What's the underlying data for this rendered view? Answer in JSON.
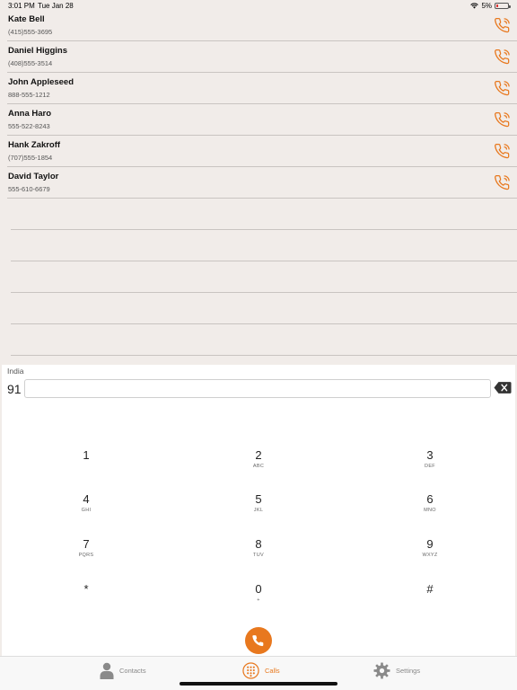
{
  "status": {
    "time": "3:01 PM",
    "date": "Tue Jan 28",
    "battery": "5%"
  },
  "contacts": [
    {
      "name": "Kate Bell",
      "phone": "(415)555-3695"
    },
    {
      "name": "Daniel Higgins",
      "phone": "(408)555-3514"
    },
    {
      "name": "John Appleseed",
      "phone": "888-555-1212"
    },
    {
      "name": "Anna Haro",
      "phone": "555-522-8243"
    },
    {
      "name": "Hank Zakroff",
      "phone": "(707)555-1854"
    },
    {
      "name": "David Taylor",
      "phone": "555-610-6679"
    }
  ],
  "dialer": {
    "country": "India",
    "country_code": "91",
    "number_value": "",
    "keys": [
      {
        "digit": "1",
        "letters": ""
      },
      {
        "digit": "2",
        "letters": "ABC"
      },
      {
        "digit": "3",
        "letters": "DEF"
      },
      {
        "digit": "4",
        "letters": "GHI"
      },
      {
        "digit": "5",
        "letters": "JKL"
      },
      {
        "digit": "6",
        "letters": "MNO"
      },
      {
        "digit": "7",
        "letters": "PQRS"
      },
      {
        "digit": "8",
        "letters": "TUV"
      },
      {
        "digit": "9",
        "letters": "WXYZ"
      },
      {
        "digit": "*",
        "letters": ""
      },
      {
        "digit": "0",
        "letters": "+"
      },
      {
        "digit": "#",
        "letters": ""
      }
    ]
  },
  "tabs": {
    "contacts": "Contacts",
    "calls": "Calls",
    "settings": "Settings"
  },
  "colors": {
    "accent": "#e8781e",
    "background": "#f1ece9"
  },
  "icons": {
    "call": "phone-ringing-icon",
    "backspace": "backspace-icon",
    "contacts": "person-icon",
    "calls": "keypad-icon",
    "settings": "gear-icon"
  }
}
